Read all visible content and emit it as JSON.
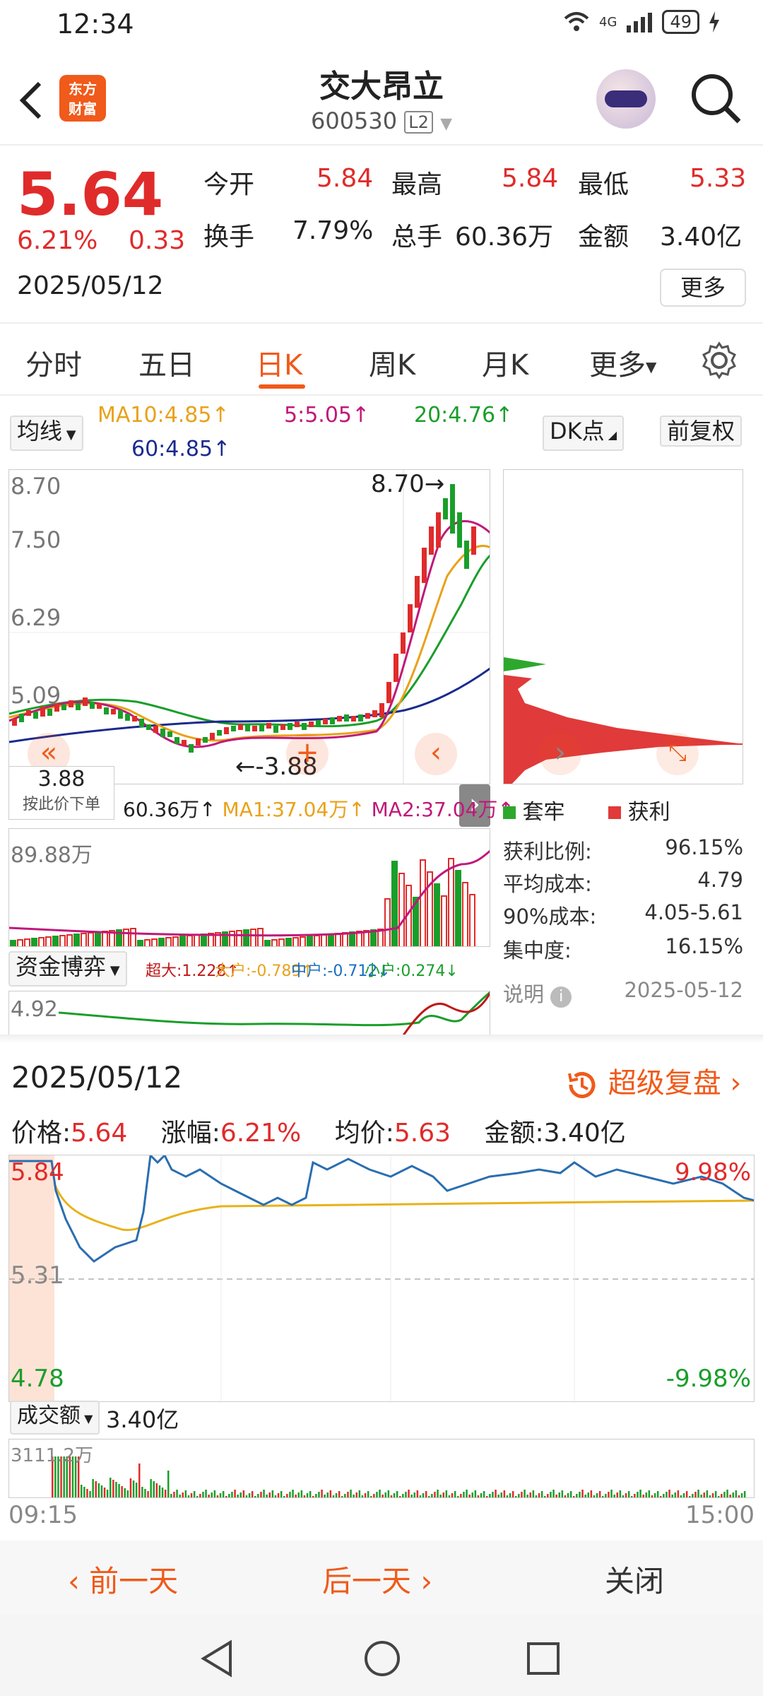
{
  "status": {
    "time": "12:34",
    "battery": "49",
    "network": "4G"
  },
  "header": {
    "name": "交大昂立",
    "code": "600530",
    "l2": "L2",
    "logo_line1": "东方",
    "logo_line2": "财富"
  },
  "quote": {
    "price": "5.64",
    "change_pct": "6.21%",
    "change": "0.33",
    "date": "2025/05/12",
    "open_label": "今开",
    "open": "5.84",
    "high_label": "最高",
    "high": "5.84",
    "low_label": "最低",
    "low": "5.33",
    "turnover_label": "换手",
    "turnover": "7.79%",
    "volume_label": "总手",
    "volume": "60.36万",
    "amount_label": "金额",
    "amount": "3.40亿",
    "more": "更多"
  },
  "tabs": [
    "分时",
    "五日",
    "日K",
    "周K",
    "月K",
    "更多"
  ],
  "ma": {
    "select": "均线",
    "ma10": "MA10:4.85↑",
    "ma5": "5:5.05↑",
    "ma20": "20:4.76↑",
    "ma60": "60:4.85↑",
    "dk": "DK点",
    "fq": "前复权"
  },
  "kline": {
    "y_labels": [
      "8.70",
      "7.50",
      "6.29",
      "5.09"
    ],
    "high_mark": "8.70→",
    "low_mark": "←-3.88"
  },
  "order_box": {
    "price": "3.88",
    "label": "按此价下单"
  },
  "vol_legend": {
    "vol": "60.36万↑",
    "ma1": "MA1:37.04万↑",
    "ma2": "MA2:37.04万↑",
    "max": "89.88万"
  },
  "fund": {
    "select": "资金博弈",
    "super": "超大:1.228↑",
    "big": "大户:-0.789↑",
    "mid": "中户:-0.712↓",
    "small": "小户:0.274↓",
    "ylabel": "4.92"
  },
  "chip": {
    "legend_trapped": "套牢",
    "legend_profit": "获利",
    "rows": [
      {
        "label": "获利比例:",
        "value": "96.15%"
      },
      {
        "label": "平均成本:",
        "value": "4.79"
      },
      {
        "label": "90%成本:",
        "value": "4.05-5.61"
      },
      {
        "label": "集中度:",
        "value": "16.15%"
      }
    ],
    "note": "说明",
    "note_date": "2025-05-12"
  },
  "intraday": {
    "date": "2025/05/12",
    "replay": "超级复盘",
    "price_label": "价格:",
    "price": "5.64",
    "chg_label": "涨幅:",
    "chg": "6.21%",
    "avg_label": "均价:",
    "avg": "5.63",
    "amt_label": "金额:",
    "amt": "3.40亿",
    "top": "5.84",
    "mid": "5.31",
    "bottom": "4.78",
    "top_pct": "9.98%",
    "bottom_pct": "-9.98%",
    "amount_select": "成交额",
    "amount_total": "3.40亿",
    "vol_max": "3111.2万",
    "t_start": "09:15",
    "t_end": "15:00"
  },
  "footer": {
    "prev": "前一天",
    "next": "后一天",
    "close": "关闭"
  },
  "colors": {
    "up": "#e02b2b",
    "down": "#1a9e2a",
    "brand": "#f05a1a"
  }
}
